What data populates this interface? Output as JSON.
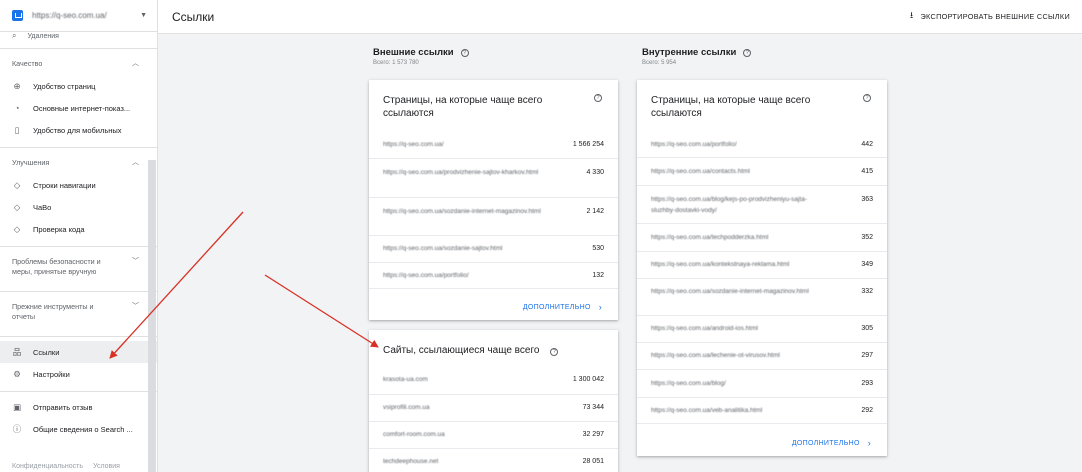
{
  "sidebar": {
    "property_url": "https://q-seo.com.ua/",
    "cut_item": "Удаления",
    "sections": [
      {
        "title": "Качество",
        "items": [
          {
            "icon": "plus-circle-icon",
            "glyph": "⊕",
            "label": "Удобство страниц"
          },
          {
            "icon": "gauge-icon",
            "glyph": "◔",
            "label": "Основные интернет-показ..."
          },
          {
            "icon": "phone-icon",
            "glyph": "▯",
            "label": "Удобство для мобильных"
          }
        ]
      },
      {
        "title": "Улучшения",
        "items": [
          {
            "icon": "diamond-icon",
            "glyph": "◇",
            "label": "Строки навигации"
          },
          {
            "icon": "diamond-icon",
            "glyph": "◇",
            "label": "ЧаВо"
          },
          {
            "icon": "diamond-icon",
            "glyph": "◇",
            "label": "Проверка кода"
          }
        ]
      }
    ],
    "security_title": "Проблемы безопасности и меры, принятые вручную",
    "legacy_title": "Прежние инструменты и отчеты",
    "links_label": "Ссылки",
    "settings_label": "Настройки",
    "feedback_label": "Отправить отзыв",
    "about_label": "Общие сведения о Search ...",
    "footer_privacy": "Конфиденциальность",
    "footer_terms": "Условия"
  },
  "header": {
    "title": "Ссылки",
    "export_label": "ЭКСПОРТИРОВАТЬ ВНЕШНИЕ ССЫЛКИ"
  },
  "external": {
    "title": "Внешние ссылки",
    "total": "Всего: 1 573 780",
    "pages_card": {
      "title": "Страницы, на которые чаще всего ссылаются",
      "rows": [
        {
          "url": "https://q-seo.com.ua/",
          "value": "1 566 254"
        },
        {
          "url": "https://q-seo.com.ua/prodvizhenie-sajtov-kharkov.html",
          "value": "4 330"
        },
        {
          "url": "https://q-seo.com.ua/sozdanie-internet-magazinov.html",
          "value": "2 142"
        },
        {
          "url": "https://q-seo.com.ua/sozdanie-sajtov.html",
          "value": "530"
        },
        {
          "url": "https://q-seo.com.ua/portfolio/",
          "value": "132"
        }
      ],
      "more_label": "ДОПОЛНИТЕЛЬНО"
    },
    "sites_card": {
      "title": "Сайты, ссылающиеся чаще всего",
      "rows": [
        {
          "url": "krasota-ua.com",
          "value": "1 300 042"
        },
        {
          "url": "vsiprofili.com.ua",
          "value": "73 344"
        },
        {
          "url": "comfort-room.com.ua",
          "value": "32 297"
        },
        {
          "url": "techdeephouse.net",
          "value": "28 051"
        }
      ]
    }
  },
  "internal": {
    "title": "Внутренние ссылки",
    "total": "Всего: 5 954",
    "pages_card": {
      "title": "Страницы, на которые чаще всего ссылаются",
      "rows": [
        {
          "url": "https://q-seo.com.ua/portfolio/",
          "value": "442"
        },
        {
          "url": "https://q-seo.com.ua/contacts.html",
          "value": "415"
        },
        {
          "url": "https://q-seo.com.ua/blog/kejs-po-prodvizheniyu-sajta-sluzhby-dostavki-vody/",
          "value": "363"
        },
        {
          "url": "https://q-seo.com.ua/techpodderzka.html",
          "value": "352"
        },
        {
          "url": "https://q-seo.com.ua/kontekstnaya-reklama.html",
          "value": "349"
        },
        {
          "url": "https://q-seo.com.ua/sozdanie-internet-magazinov.html",
          "value": "332"
        },
        {
          "url": "https://q-seo.com.ua/android-ios.html",
          "value": "305"
        },
        {
          "url": "https://q-seo.com.ua/lechenie-ot-virusov.html",
          "value": "297"
        },
        {
          "url": "https://q-seo.com.ua/blog/",
          "value": "293"
        },
        {
          "url": "https://q-seo.com.ua/veb-analitika.html",
          "value": "292"
        }
      ],
      "more_label": "ДОПОЛНИТЕЛЬНО"
    }
  },
  "colors": {
    "accent": "#1a73e8",
    "annotation_arrow": "#d93025"
  }
}
